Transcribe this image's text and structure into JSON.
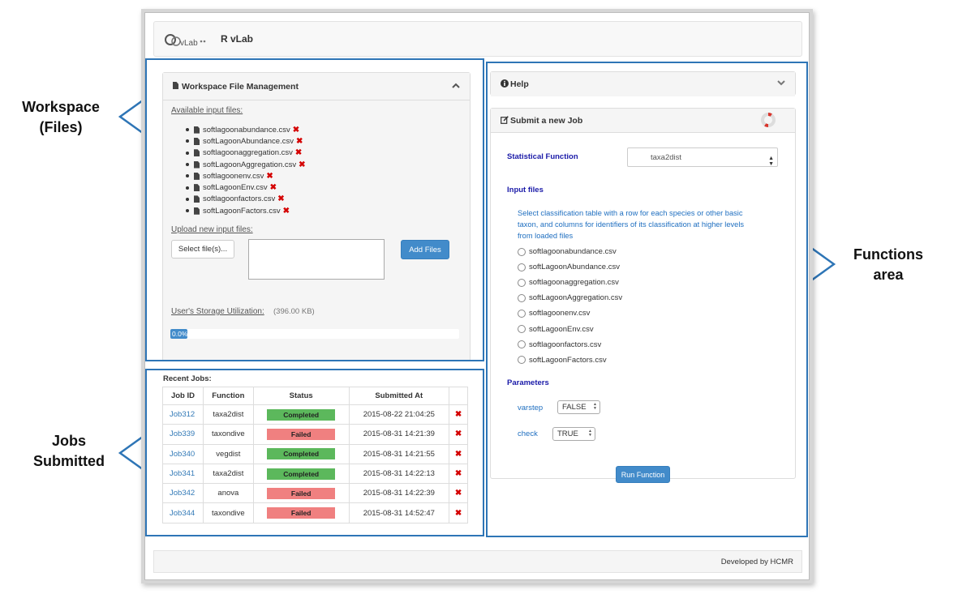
{
  "app": {
    "title": "R vLab",
    "logo_text": "vLab"
  },
  "workspace": {
    "title": "Workspace File Management",
    "available_label": "Available input files:",
    "files": [
      "softlagoonabundance.csv",
      "softLagoonAbundance.csv",
      "softlagoonaggregation.csv",
      "softLagoonAggregation.csv",
      "softlagoonenv.csv",
      "softLagoonEnv.csv",
      "softlagoonfactors.csv",
      "softLagoonFactors.csv"
    ],
    "upload_label": "Upload new input files:",
    "select_button": "Select file(s)...",
    "add_button": "Add Files",
    "storage_label": "User's Storage Utilization:",
    "storage_value": "(396.00 KB)",
    "progress_text": "0.0%",
    "progress_fraction": 0.06
  },
  "jobs": {
    "title": "Recent Jobs:",
    "columns": [
      "Job ID",
      "Function",
      "Status",
      "Submitted At",
      ""
    ],
    "rows": [
      {
        "id": "Job312",
        "function": "taxa2dist",
        "status": "Completed",
        "submitted": "2015-08-22 21:04:25"
      },
      {
        "id": "Job339",
        "function": "taxondive",
        "status": "Failed",
        "submitted": "2015-08-31 14:21:39"
      },
      {
        "id": "Job340",
        "function": "vegdist",
        "status": "Completed",
        "submitted": "2015-08-31 14:21:55"
      },
      {
        "id": "Job341",
        "function": "taxa2dist",
        "status": "Completed",
        "submitted": "2015-08-31 14:22:13"
      },
      {
        "id": "Job342",
        "function": "anova",
        "status": "Failed",
        "submitted": "2015-08-31 14:22:39"
      },
      {
        "id": "Job344",
        "function": "taxondive",
        "status": "Failed",
        "submitted": "2015-08-31 14:52:47"
      }
    ]
  },
  "help": {
    "title": "Help"
  },
  "submit": {
    "title": "Submit a new Job",
    "stat_label": "Statistical Function",
    "stat_value": "taxa2dist",
    "input_files_label": "Input files",
    "input_desc": "Select classification table with a row for each species or other basic taxon, and columns for identifiers of its classification at higher levels from loaded files",
    "radio_files": [
      "softlagoonabundance.csv",
      "softLagoonAbundance.csv",
      "softlagoonaggregation.csv",
      "softLagoonAggregation.csv",
      "softlagoonenv.csv",
      "softLagoonEnv.csv",
      "softlagoonfactors.csv",
      "softLagoonFactors.csv"
    ],
    "parameters_label": "Parameters",
    "varstep_label": "varstep",
    "varstep_value": "FALSE",
    "check_label": "check",
    "check_value": "TRUE",
    "run_button": "Run Function"
  },
  "footer": {
    "text": "Developed by HCMR"
  },
  "annotations": {
    "workspace": "Workspace\n(Files)",
    "jobs": "Jobs\nSubmitted",
    "functions": "Functions\narea"
  },
  "colors": {
    "annotation_blue": "#2e75b6",
    "primary": "#428bca",
    "completed": "#5cb85c",
    "failed": "#f08080",
    "delete": "#d40000"
  },
  "icons": [
    "file-icon",
    "delete-icon",
    "info-icon",
    "chevron-up-icon",
    "chevron-down-icon",
    "edit-icon",
    "lifebuoy-icon"
  ]
}
